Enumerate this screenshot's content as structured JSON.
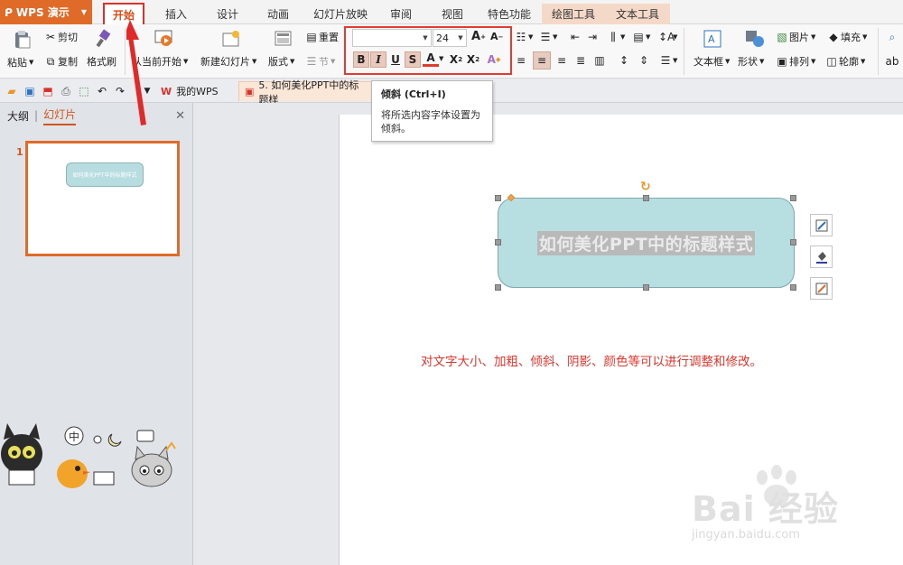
{
  "app": {
    "name": "WPS 演示",
    "accent": "#e06b29"
  },
  "tabs": [
    {
      "label": "开始",
      "active": true
    },
    {
      "label": "插入"
    },
    {
      "label": "设计"
    },
    {
      "label": "动画"
    },
    {
      "label": "幻灯片放映"
    },
    {
      "label": "审阅"
    },
    {
      "label": "视图"
    },
    {
      "label": "特色功能"
    },
    {
      "label": "绘图工具",
      "contextual": true
    },
    {
      "label": "文本工具",
      "contextual": true
    }
  ],
  "ribbon": {
    "paste": "粘贴",
    "cut": "剪切",
    "copy": "复制",
    "format_painter": "格式刷",
    "from_current": "从当前开始",
    "new_slide": "新建幻灯片",
    "layout": "版式",
    "reset": "重置",
    "section": "节",
    "font_name": "",
    "font_size": "24",
    "text_box": "文本框",
    "shape": "形状",
    "picture": "图片",
    "arrange": "排列",
    "fill": "填充",
    "outline": "轮廓"
  },
  "quick_access": {
    "my_wps": "我的WPS",
    "doc_tab": "5. 如何美化PPT中的标题样"
  },
  "tooltip": {
    "title": "倾斜 (Ctrl+I)",
    "desc": "将所选内容字体设置为倾斜。"
  },
  "left_panel": {
    "outline_tab": "大纲",
    "slides_tab": "幻灯片",
    "slide_number": "1",
    "thumb_text": "如何美化PPT中的标题样式"
  },
  "slide": {
    "title_text": "如何美化PPT中的标题样式",
    "note": "对文字大小、加粗、倾斜、阴影、颜色等可以进行调整和修改。"
  },
  "watermark": {
    "brand": "Bai 经验",
    "url": "jingyan.baidu.com"
  }
}
